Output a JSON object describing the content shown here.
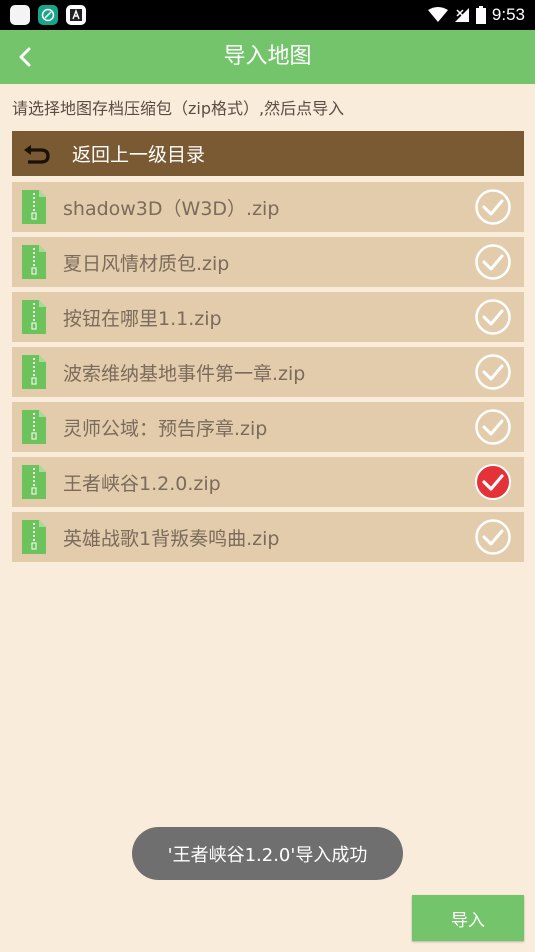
{
  "status_bar": {
    "time": "9:53"
  },
  "header": {
    "title": "导入地图"
  },
  "hint": "请选择地图存档压缩包（zip格式）,然后点导入",
  "parent_dir": {
    "label": "返回上一级目录"
  },
  "files": [
    {
      "name": "shadow3D（W3D）.zip",
      "checked": false
    },
    {
      "name": "夏日风情材质包.zip",
      "checked": false
    },
    {
      "name": "按钮在哪里1.1.zip",
      "checked": false
    },
    {
      "name": "波索维纳基地事件第一章.zip",
      "checked": false
    },
    {
      "name": "灵师公域：预告序章.zip",
      "checked": false
    },
    {
      "name": "王者峡谷1.2.0.zip",
      "checked": true
    },
    {
      "name": "英雄战歌1背叛奏鸣曲.zip",
      "checked": false
    }
  ],
  "toast": "'王者峡谷1.2.0'导入成功",
  "import_button": {
    "label": "导入"
  },
  "colors": {
    "accent": "#74c46b",
    "background": "#f9ecdb",
    "row": "#e2ccab",
    "parent_row": "#7a5a32",
    "checked": "#e53238"
  }
}
